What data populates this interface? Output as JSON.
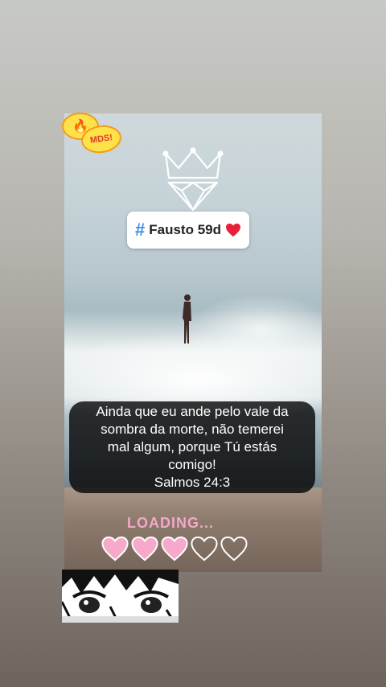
{
  "sticker": {
    "icon": "fire-emoji",
    "text": "MDS!"
  },
  "tag": {
    "hash": "#",
    "name": "Fausto 59d",
    "heart_color": "#e8213a"
  },
  "caption": {
    "lines": [
      "Ainda que eu ande pelo vale da",
      "sombra da morte, não temerei",
      "mal algum, porque Tú estás",
      "comigo!",
      "Salmos 24:3"
    ]
  },
  "loading": {
    "text": "LOADING...",
    "hearts_filled": 3,
    "hearts_total": 5,
    "color": "#f3a8c8"
  }
}
